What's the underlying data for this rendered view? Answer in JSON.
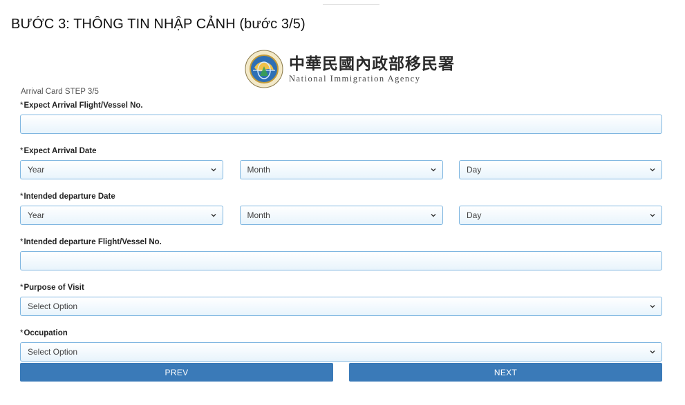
{
  "page": {
    "heading": "BƯỚC 3: THÔNG TIN NHẬP CẢNH (bước 3/5)"
  },
  "logo": {
    "name_zh": "中華民國內政部移民署",
    "name_en": "National Immigration Agency",
    "emblem_icon": "immigration-agency-emblem-icon"
  },
  "form": {
    "step_caption": "Arrival Card STEP 3/5",
    "required_marker": "*",
    "arrival_flight": {
      "label": "Expect Arrival Flight/Vessel No.",
      "value": "",
      "placeholder": ""
    },
    "arrival_date": {
      "label": "Expect Arrival Date",
      "year": "Year",
      "month": "Month",
      "day": "Day"
    },
    "departure_date": {
      "label": "Intended departure Date",
      "year": "Year",
      "month": "Month",
      "day": "Day"
    },
    "departure_flight": {
      "label": "Intended departure Flight/Vessel No.",
      "value": "",
      "placeholder": ""
    },
    "purpose": {
      "label": "Purpose of Visit",
      "selected": "Select Option"
    },
    "occupation": {
      "label": "Occupation",
      "selected": "Select Option"
    }
  },
  "buttons": {
    "prev": "PREV",
    "next": "NEXT"
  },
  "colors": {
    "input_border": "#7fb6e0",
    "input_fill": "#e8f4fc",
    "button": "#3a7ab8",
    "button_text": "#ffffff"
  }
}
